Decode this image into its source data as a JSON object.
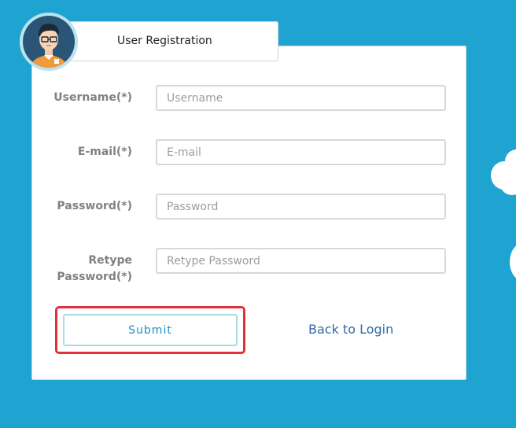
{
  "header": {
    "title": "User Registration",
    "avatar_icon": "user-avatar-icon"
  },
  "form": {
    "username": {
      "label": "Username(*)",
      "placeholder": "Username",
      "value": ""
    },
    "email": {
      "label": "E-mail(*)",
      "placeholder": "E-mail",
      "value": ""
    },
    "password": {
      "label": "Password(*)",
      "placeholder": "Password",
      "value": ""
    },
    "retype_password": {
      "label_line1": "Retype",
      "label_line2": "Password(*)",
      "placeholder": "Retype Password",
      "value": ""
    }
  },
  "actions": {
    "submit_label": "Submit",
    "back_label": "Back to Login"
  },
  "colors": {
    "background": "#1fa3d0",
    "card": "#ffffff",
    "label": "#7d8285",
    "submit_text": "#1a94c5",
    "link": "#2f6aa6",
    "highlight": "#e0323a"
  }
}
